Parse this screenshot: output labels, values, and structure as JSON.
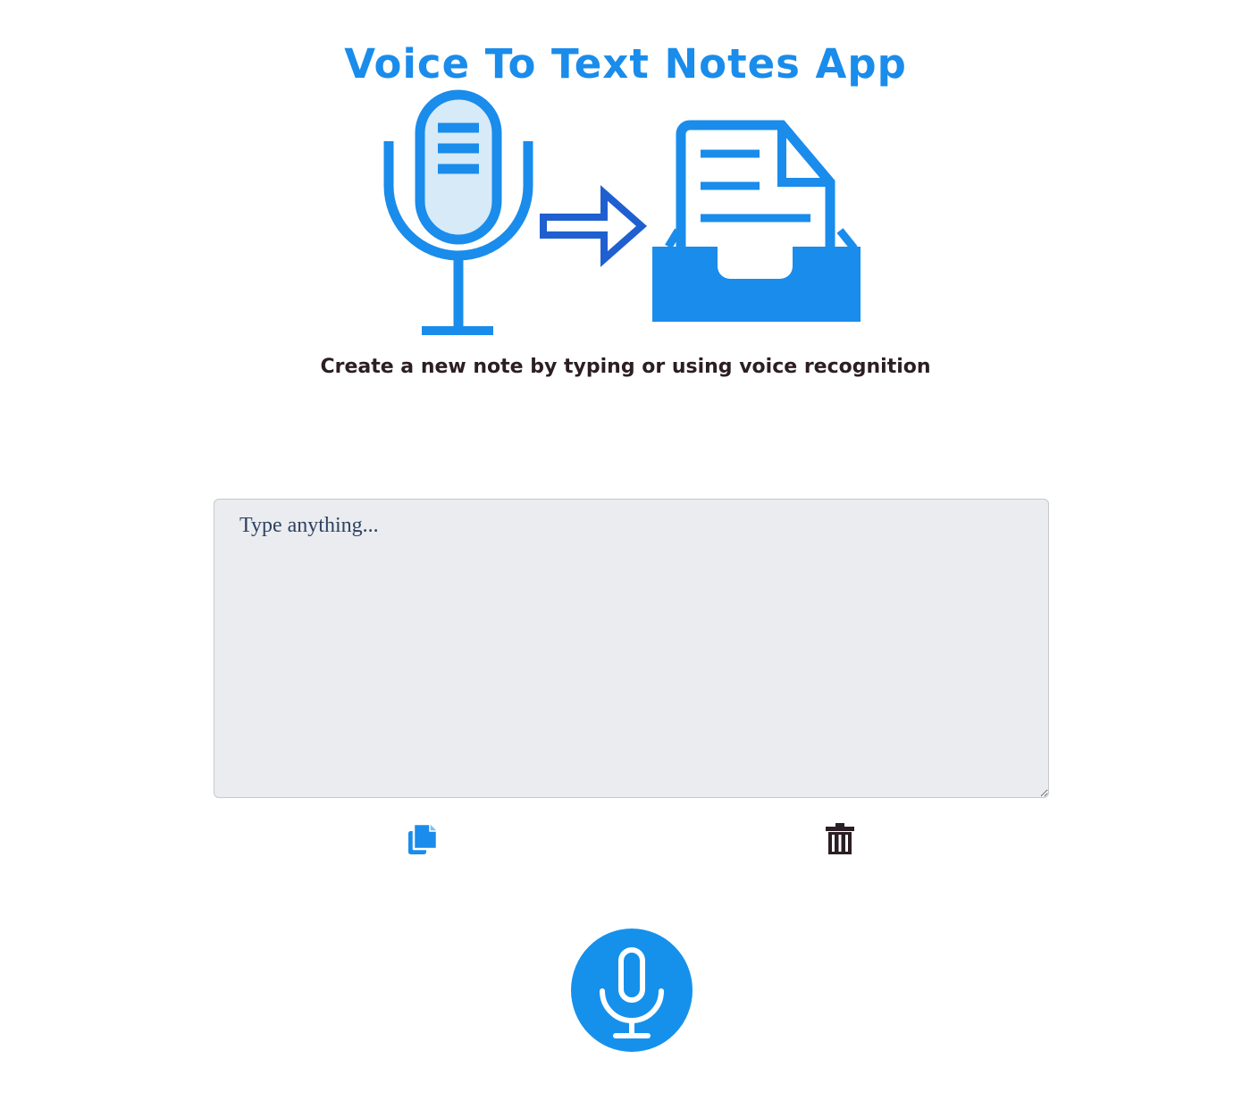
{
  "header": {
    "title": "Voice To Text Notes App",
    "subtitle": "Create a new note by typing or using voice recognition"
  },
  "hero": {
    "icons": [
      "microphone-icon",
      "arrow-right-icon",
      "document-tray-icon"
    ]
  },
  "note": {
    "placeholder": "Type anything...",
    "value": ""
  },
  "actions": {
    "copy_icon": "copy-icon",
    "clear_icon": "trash-icon",
    "record_icon": "microphone-icon"
  },
  "colors": {
    "accent": "#1a8ceb",
    "accent_dark": "#1f5fd0",
    "accent_light": "#d6eaf8",
    "text_dark": "#2b1e24",
    "input_bg": "#ebecf0",
    "mic_button": "#1591ec",
    "trash_icon": "#2b1e24"
  }
}
